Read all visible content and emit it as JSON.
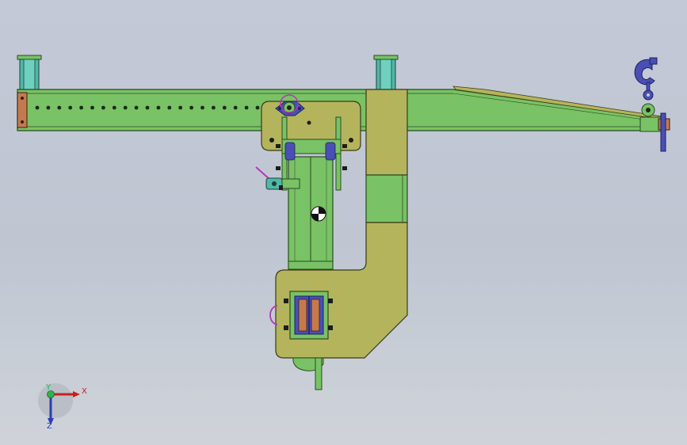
{
  "viewport": {
    "background_top": "#c3c9d6",
    "background_bottom": "#cfd3d9"
  },
  "model": {
    "beam_color": "#79c265",
    "plate_color": "#b4b45d",
    "hook_color": "#4a4fb5",
    "post_color": "#4fb8a8",
    "accent_magenta": "#b437b8",
    "end_plate_color": "#c47a4e",
    "hole_count": 21
  },
  "triad": {
    "x_label": "X",
    "y_label": "Y",
    "z_label": "Z",
    "x_color": "#c8201f",
    "z_color": "#2b3fb3",
    "y_color": "#2fb24a"
  }
}
